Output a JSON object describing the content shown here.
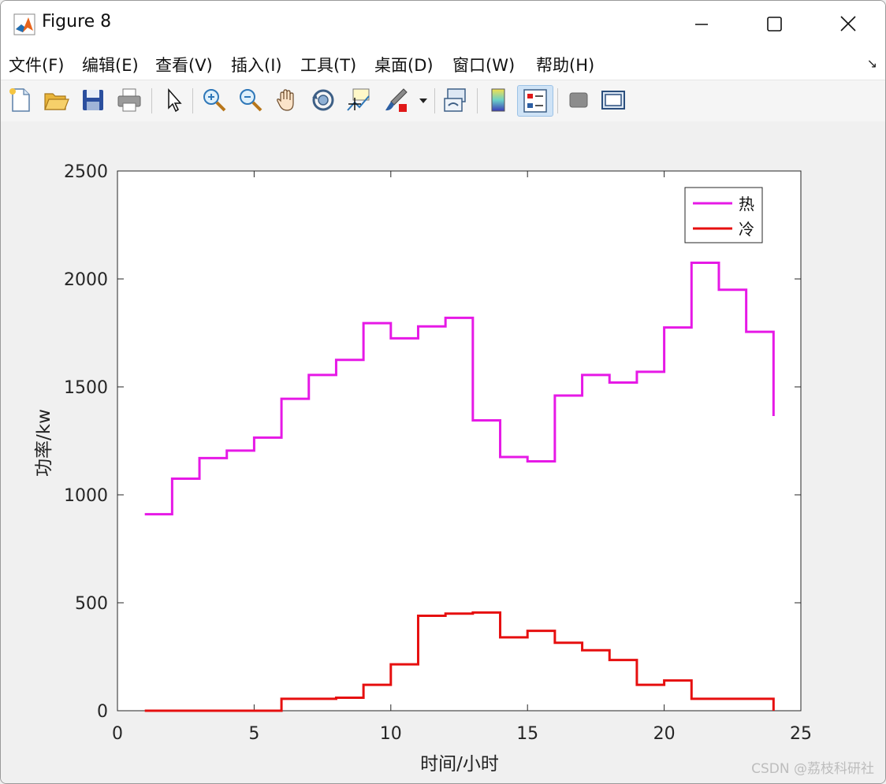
{
  "window": {
    "title": "Figure 8"
  },
  "menu": [
    {
      "label": "文件(F)"
    },
    {
      "label": "编辑(E)"
    },
    {
      "label": "查看(V)"
    },
    {
      "label": "插入(I)"
    },
    {
      "label": "工具(T)"
    },
    {
      "label": "桌面(D)"
    },
    {
      "label": "窗口(W)"
    },
    {
      "label": "帮助(H)"
    }
  ],
  "menu_overflow_icon": "↘",
  "toolbar_icons": [
    "new-figure-icon",
    "open-file-icon",
    "save-icon",
    "print-icon",
    "select-pointer-icon",
    "zoom-in-icon",
    "zoom-out-icon",
    "pan-hand-icon",
    "rotate-3d-icon",
    "data-cursor-icon",
    "brush-icon",
    "brush-dropdown-icon",
    "link-plot-icon",
    "colorbar-icon",
    "legend-icon",
    "hide-plot-tools-icon",
    "show-plot-tools-icon"
  ],
  "watermark": "CSDN @荔枝科研社",
  "chart_data": {
    "type": "line",
    "step": true,
    "title": "",
    "xlabel": "时间/小时",
    "ylabel": "功率/kw",
    "xlim": [
      0,
      25
    ],
    "ylim": [
      0,
      2500
    ],
    "xticks": [
      0,
      5,
      10,
      15,
      20,
      25
    ],
    "yticks": [
      0,
      500,
      1000,
      1500,
      2000,
      2500
    ],
    "grid": false,
    "legend_position": "top-right",
    "x": [
      1,
      2,
      3,
      4,
      5,
      6,
      7,
      8,
      9,
      10,
      11,
      12,
      13,
      14,
      15,
      16,
      17,
      18,
      19,
      20,
      21,
      22,
      23,
      24
    ],
    "series": [
      {
        "name": "热",
        "color": "#e619e6",
        "values": [
          910,
          1075,
          1170,
          1205,
          1265,
          1445,
          1555,
          1625,
          1795,
          1725,
          1780,
          1820,
          1345,
          1175,
          1155,
          1460,
          1555,
          1520,
          1570,
          1775,
          2075,
          1950,
          1755,
          1365
        ]
      },
      {
        "name": "冷",
        "color": "#e60f0f",
        "values": [
          0,
          0,
          0,
          0,
          0,
          55,
          55,
          60,
          120,
          215,
          440,
          450,
          455,
          340,
          370,
          315,
          280,
          235,
          120,
          140,
          55,
          55,
          55,
          0
        ]
      }
    ]
  }
}
